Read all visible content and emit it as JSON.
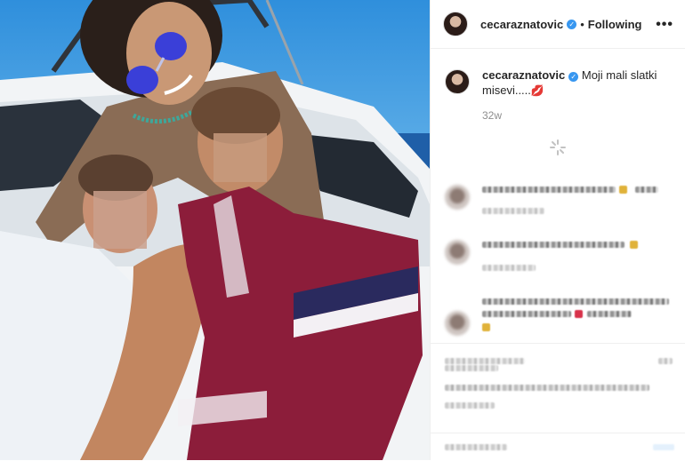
{
  "header": {
    "username": "cecaraznatovic",
    "verified_glyph": "✓",
    "separator": "•",
    "follow_state": "Following",
    "more_glyph": "•••"
  },
  "caption": {
    "username": "cecaraznatovic",
    "verified_glyph": "✓",
    "text": "Moji mali slatki misevi.....",
    "emoji": "💋",
    "timestamp": "32w"
  },
  "icons": {
    "avatar": "avatar-icon",
    "verified": "verified-badge-icon",
    "more": "more-options-icon",
    "loader": "loading-spinner-icon"
  },
  "colors": {
    "verified": "#3897f0",
    "muted_text": "#8e8e8e",
    "border": "#efefef"
  }
}
